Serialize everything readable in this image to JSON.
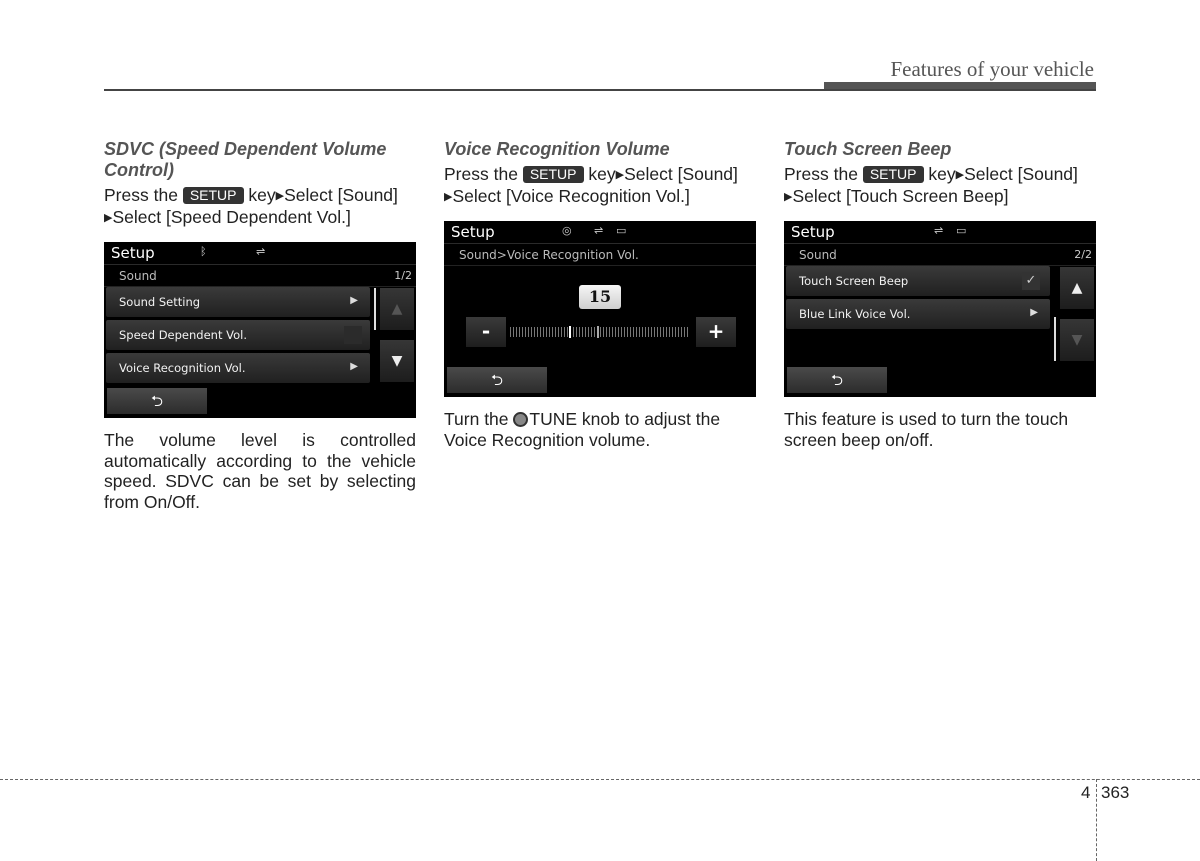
{
  "header": {
    "title": "Features of your vehicle"
  },
  "sections": [
    {
      "title": "SDVC (Speed Dependent Volume Control)",
      "instruction": {
        "prefix": "Press the",
        "key": "SETUP",
        "middle": "key",
        "step1": "Select [Sound]",
        "step2": "Select [Speed Dependent Vol.]"
      },
      "screen": {
        "title": "Setup",
        "status_icons": [
          "bluetooth-icon",
          "usb-icon"
        ],
        "subtitle": "Sound",
        "page": "1/2",
        "items": [
          {
            "label": "Sound Setting",
            "control": "arrow"
          },
          {
            "label": "Speed Dependent Vol.",
            "control": "checkbox",
            "checked": false
          },
          {
            "label": "Voice Recognition Vol.",
            "control": "arrow"
          }
        ],
        "scroll_up_enabled": false,
        "scroll_down_enabled": true
      },
      "description": "The volume level is controlled automatically according to the vehicle speed. SDVC can be set by selecting from On/Off."
    },
    {
      "title": "Voice Recognition Volume",
      "instruction": {
        "prefix": "Press the",
        "key": "SETUP",
        "middle": "key",
        "step1": "Select [Sound]",
        "step2": "Select [Voice Recognition Vol.]"
      },
      "screen": {
        "title": "Setup",
        "status_icons": [
          "disc-icon",
          "usb-icon",
          "battery-icon"
        ],
        "subtitle": "Sound>Voice Recognition Vol.",
        "volume_value": "15",
        "volume_fraction": 0.33,
        "minus_label": "-",
        "plus_label": "+"
      },
      "description": {
        "prefix": "Turn the",
        "knob": "TUNE",
        "suffix": "knob to adjust the Voice Recognition volume."
      }
    },
    {
      "title": "Touch Screen Beep",
      "instruction": {
        "prefix": "Press the",
        "key": "SETUP",
        "middle": "key",
        "step1": "Select [Sound]",
        "step2": "Select [Touch Screen Beep]"
      },
      "screen": {
        "title": "Setup",
        "status_icons": [
          "usb-icon",
          "battery-icon"
        ],
        "subtitle": "Sound",
        "page": "2/2",
        "items": [
          {
            "label": "Touch Screen Beep",
            "control": "checkbox",
            "checked": true
          },
          {
            "label": "Blue Link Voice Vol.",
            "control": "arrow"
          }
        ],
        "scroll_up_enabled": true,
        "scroll_down_enabled": false
      },
      "description": "This feature is used to turn the touch screen beep on/off."
    }
  ],
  "footer": {
    "chapter": "4",
    "page": "363"
  },
  "glyphs": {
    "arrow_right": "▶",
    "arrow_up": "▲",
    "arrow_down": "▼",
    "check": "✓",
    "back": "⮌",
    "bluetooth": "ᛒ",
    "usb": "⇌",
    "disc": "◎",
    "battery": "▭"
  }
}
